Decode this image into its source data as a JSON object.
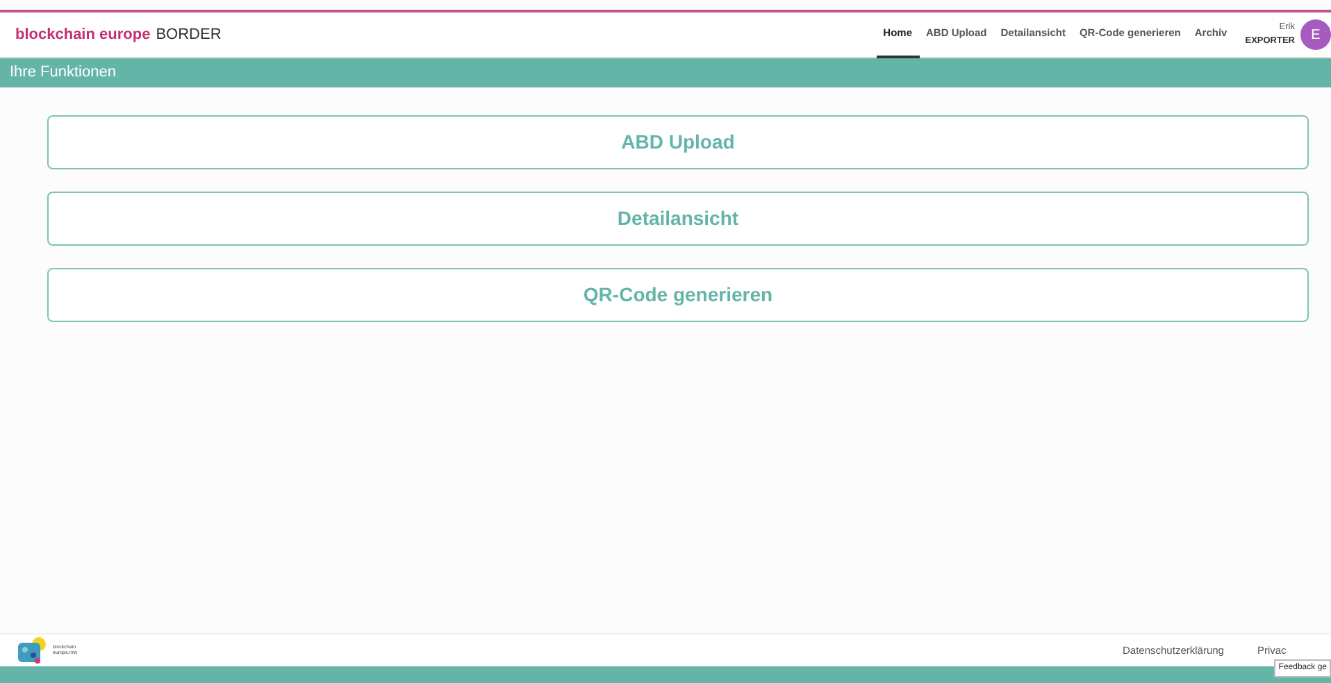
{
  "brand": {
    "highlight": "blockchain europe",
    "name": "BORDER"
  },
  "nav": [
    {
      "label": "Home",
      "selected": true
    },
    {
      "label": "ABD Upload",
      "selected": false
    },
    {
      "label": "Detailansicht",
      "selected": false
    },
    {
      "label": "QR-Code generieren",
      "selected": false
    },
    {
      "label": "Archiv",
      "selected": false
    }
  ],
  "user": {
    "name": "Erik",
    "role": "EXPORTER",
    "initial": "E"
  },
  "section_title": "Ihre Funktionen",
  "functions": [
    "ABD Upload",
    "Detailansicht",
    "QR-Code generieren"
  ],
  "footer": {
    "logo_text": [
      "blockchain",
      "europe.nrw"
    ],
    "links": [
      "Datenschutzerklärung",
      "Privac"
    ],
    "tooltip": "Feedback ge"
  }
}
